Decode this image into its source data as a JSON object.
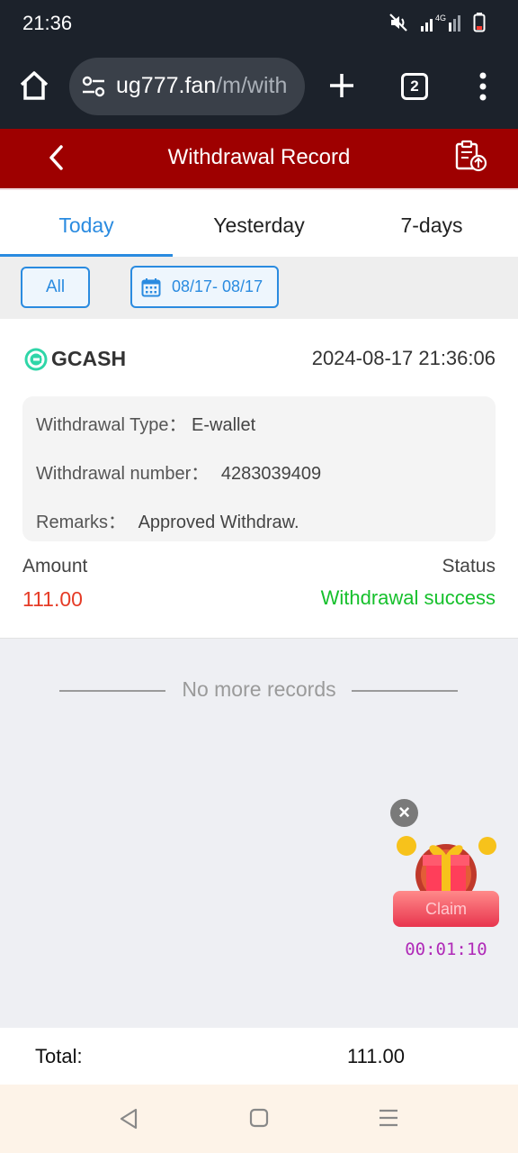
{
  "status_bar": {
    "time": "21:36",
    "network": "4G"
  },
  "browser": {
    "url_host": "ug777.fan",
    "url_path": "/m/with",
    "tab_count": "2"
  },
  "header": {
    "title": "Withdrawal Record"
  },
  "tabs": [
    {
      "label": "Today",
      "active": true
    },
    {
      "label": "Yesterday",
      "active": false
    },
    {
      "label": "7-days",
      "active": false
    }
  ],
  "filters": {
    "all_label": "All",
    "date_range": "08/17- 08/17"
  },
  "record": {
    "method": "GCASH",
    "datetime": "2024-08-17 21:36:06",
    "type_label": "Withdrawal Type：",
    "type_value": "E-wallet",
    "number_label": "Withdrawal number：",
    "number_value": "4283039409",
    "remarks_label": "Remarks：",
    "remarks_value": "Approved Withdraw.",
    "amount_label": "Amount",
    "amount_value": "111.00",
    "status_label": "Status",
    "status_value": "Withdrawal success"
  },
  "list_end_text": "No more records",
  "gift_widget": {
    "claim_label": "Claim",
    "timer": "00:01:10"
  },
  "total": {
    "label": "Total:",
    "value": "111.00"
  },
  "colors": {
    "header_red": "#9e0000",
    "active_blue": "#2a8be0",
    "amount_red": "#e53b26",
    "success_green": "#16c02c"
  }
}
